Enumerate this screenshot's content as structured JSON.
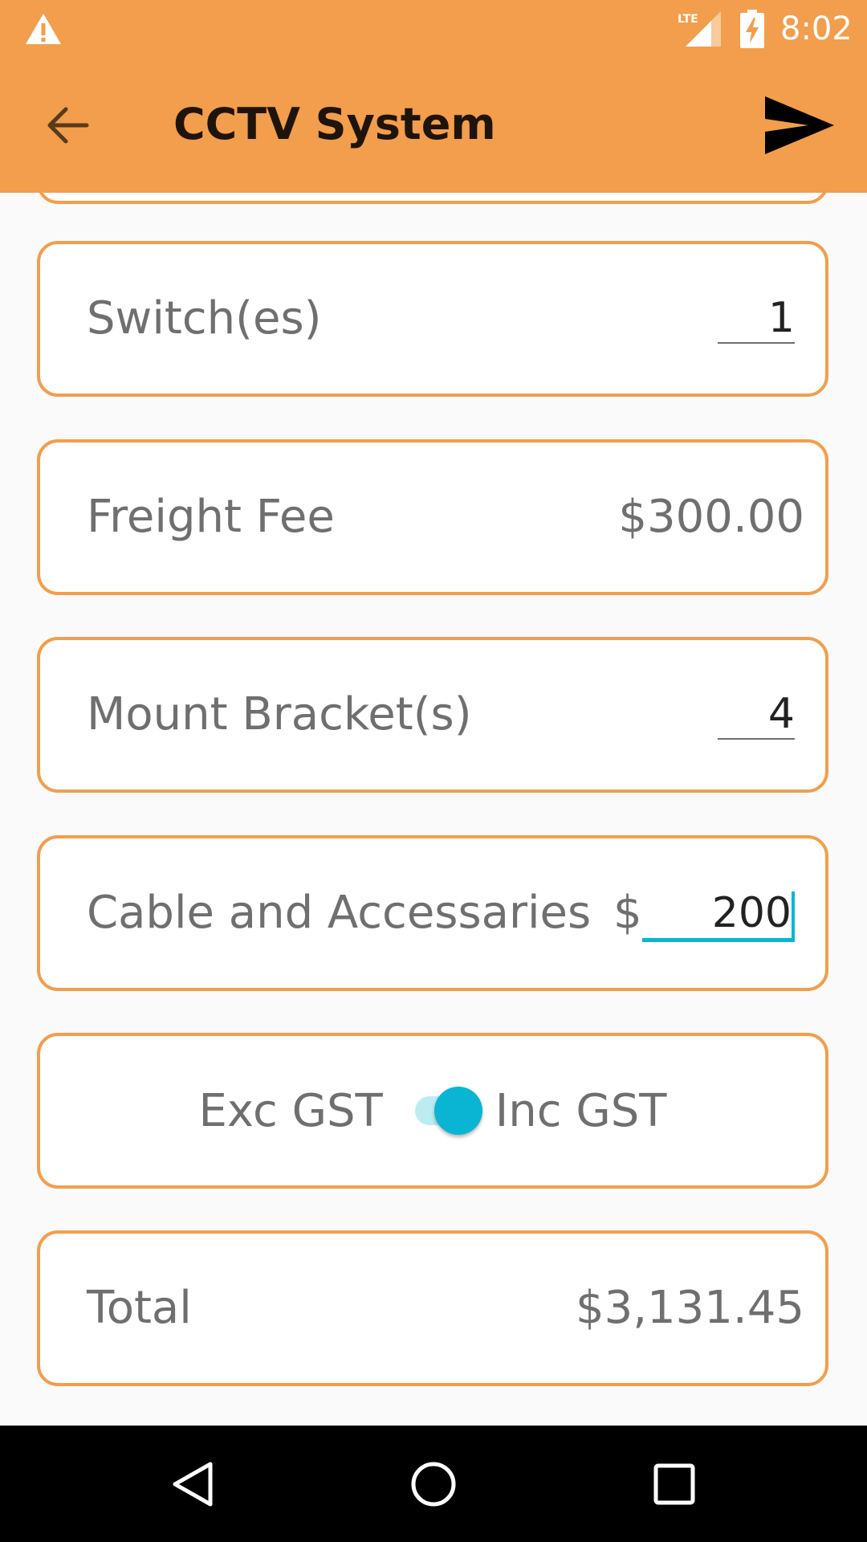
{
  "status_bar": {
    "time": "8:02",
    "network": "LTE",
    "icons": [
      "warning-icon",
      "lte-signal-icon",
      "battery-charging-icon"
    ]
  },
  "app_bar": {
    "title": "CCTV System",
    "back_icon": "arrow-back-icon",
    "send_icon": "send-icon"
  },
  "items": {
    "switches": {
      "label": "Switch(es)",
      "value": "1"
    },
    "freight": {
      "label": "Freight Fee",
      "value": "$300.00"
    },
    "mount_brackets": {
      "label": "Mount Bracket(s)",
      "value": "4"
    },
    "cable": {
      "label": "Cable and Accessaries",
      "currency": "$",
      "value": "200"
    }
  },
  "gst": {
    "off_label": "Exc GST",
    "on_label": "Inc GST",
    "checked": true
  },
  "total": {
    "label": "Total",
    "value": "$3,131.45"
  },
  "colors": {
    "primary": "#F29E4C",
    "accent": "#0AB5D3",
    "text_secondary": "#6F6F6F",
    "background": "#FAFAFA"
  },
  "nav": [
    "back-triangle-icon",
    "home-circle-icon",
    "recents-square-icon"
  ]
}
